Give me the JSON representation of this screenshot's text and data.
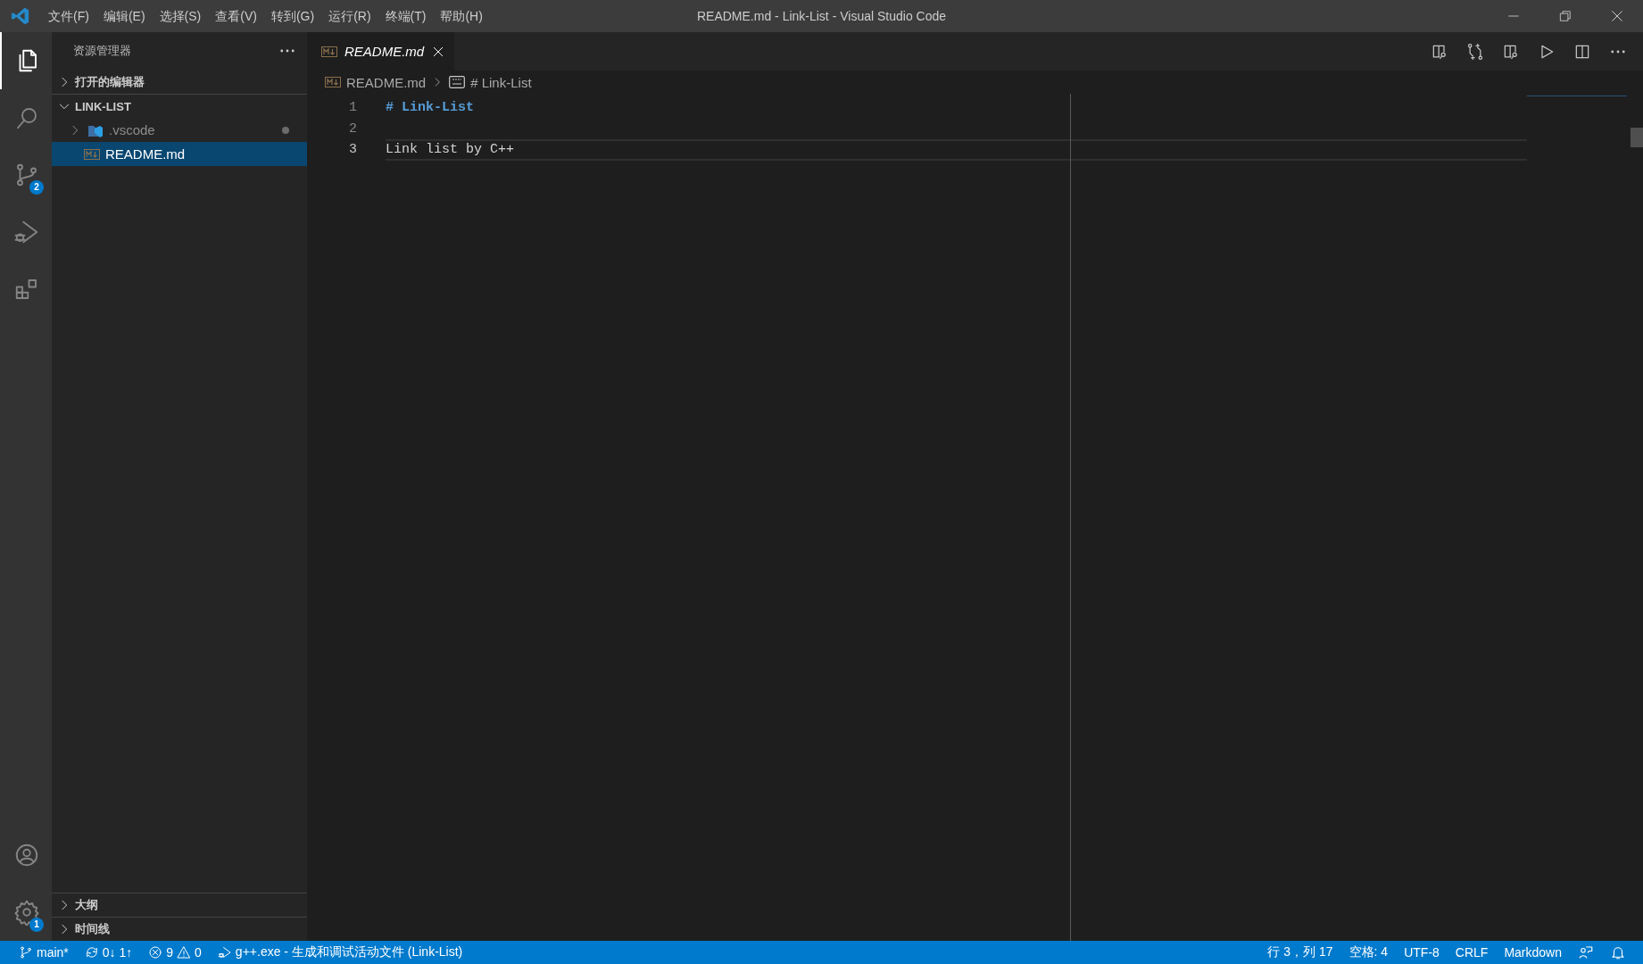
{
  "window": {
    "title": "README.md - Link-List - Visual Studio Code"
  },
  "menu": [
    "文件(F)",
    "编辑(E)",
    "选择(S)",
    "查看(V)",
    "转到(G)",
    "运行(R)",
    "终端(T)",
    "帮助(H)"
  ],
  "activity_bar": {
    "top": [
      {
        "kind": "explorer",
        "selected": true
      },
      {
        "kind": "search",
        "selected": false
      },
      {
        "kind": "scm",
        "selected": false,
        "badge": "2"
      },
      {
        "kind": "debug",
        "selected": false
      },
      {
        "kind": "extensions",
        "selected": false
      }
    ],
    "bottom": [
      {
        "kind": "account",
        "selected": false
      },
      {
        "kind": "settings",
        "selected": false,
        "badge": "1"
      }
    ]
  },
  "sidebar": {
    "title": "资源管理器",
    "sections": [
      {
        "label": "打开的编辑器",
        "expanded": false
      },
      {
        "label": "LINK-LIST",
        "expanded": true,
        "children": [
          {
            "label": ".vscode",
            "kind": "folder",
            "expanded": false,
            "dimmed": true,
            "selected": false
          },
          {
            "label": "README.md",
            "kind": "markdown",
            "selected": true,
            "dimmed": false
          }
        ]
      }
    ],
    "bottom_sections": [
      {
        "label": "大纲",
        "expanded": false
      },
      {
        "label": "时间线",
        "expanded": false
      }
    ]
  },
  "tabs": [
    {
      "label": "README.md",
      "selected": true,
      "preview": true
    }
  ],
  "breadcrumb": [
    {
      "label": "README.md",
      "kind": "markdown"
    },
    {
      "label": "# Link-List",
      "kind": "heading"
    }
  ],
  "editor": {
    "lines": [
      {
        "number": "1",
        "text": "# Link-List",
        "kind": "heading",
        "current": false
      },
      {
        "number": "2",
        "current": false
      },
      {
        "number": "3",
        "text": "Link list by C++",
        "kind": "plain",
        "current": true
      }
    ]
  },
  "status_bar": {
    "left": [
      {
        "kind": "branch",
        "text": "main*"
      },
      {
        "kind": "sync",
        "text": "0↓ 1↑"
      },
      {
        "kind": "problems",
        "errors": "9",
        "warnings": "0"
      },
      {
        "kind": "debug",
        "text": "g++.exe - 生成和调试活动文件 (Link-List)"
      }
    ],
    "right": [
      {
        "kind": "text",
        "text": "行 3，列 17"
      },
      {
        "kind": "text",
        "text": "空格: 4"
      },
      {
        "kind": "text",
        "text": "UTF-8"
      },
      {
        "kind": "text",
        "text": "CRLF"
      },
      {
        "kind": "text",
        "text": "Markdown"
      },
      {
        "kind": "feedback"
      },
      {
        "kind": "bell"
      }
    ]
  }
}
